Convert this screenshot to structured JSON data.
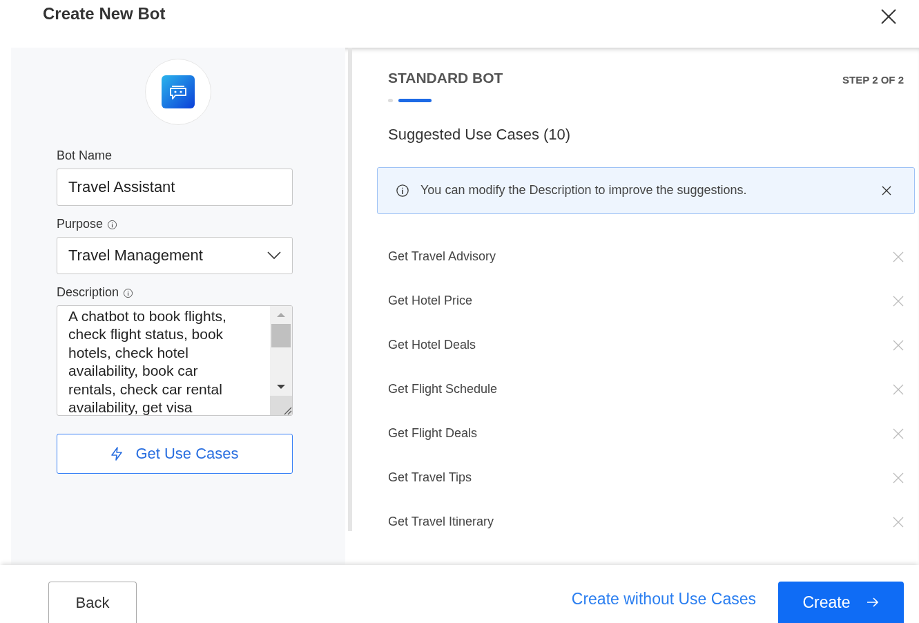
{
  "dialog": {
    "title": "Create New Bot"
  },
  "form": {
    "name_label": "Bot Name",
    "name_value": "Travel Assistant",
    "purpose_label": "Purpose",
    "purpose_value": "Travel Management",
    "description_label": "Description",
    "description_value": "A chatbot to book flights, check flight status, book hotels, check hotel availability, book car rentals, check car rental availability, get visa",
    "get_button": "Get Use Cases"
  },
  "panel": {
    "title": "STANDARD BOT",
    "step": "STEP 2 OF 2",
    "steps": [
      {
        "selected": false
      },
      {
        "selected": true
      }
    ],
    "heading": "Suggested Use Cases (10)",
    "notice": "You can modify the Description to improve the suggestions."
  },
  "use_cases": [
    "Get Travel Advisory",
    "Get Hotel Price",
    "Get Hotel Deals",
    "Get Flight Schedule",
    "Get Flight Deals",
    "Get Travel Tips",
    "Get Travel Itinerary"
  ],
  "footer": {
    "back": "Back",
    "secondary": "Create without Use Cases",
    "primary": "Create"
  }
}
